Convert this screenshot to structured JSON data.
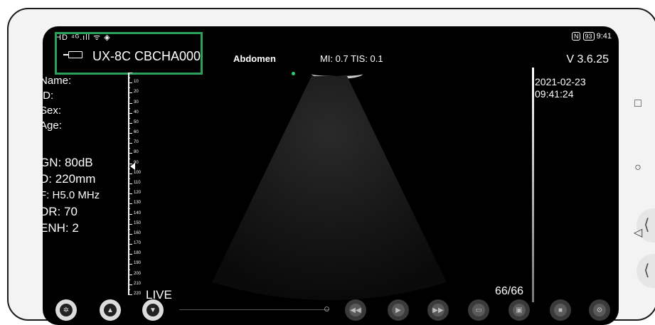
{
  "status_bar": {
    "left_icons": "HD ⁴ᴳ.ıll ᯤ ◈",
    "nfc": "N",
    "battery": "93",
    "time": "9:41"
  },
  "probe": {
    "name": "UX-8C CBCHA000"
  },
  "exam": {
    "preset": "Abdomen",
    "mi_tis": "MI: 0.7  TIS: 0.1"
  },
  "version": "V 3.6.25",
  "patient": {
    "name_label": "Name:",
    "id_label": "ID:",
    "sex_label": "Sex:",
    "age_label": "Age:"
  },
  "imaging": {
    "gain": "GN: 80dB",
    "depth": "D: 220mm",
    "frequency": "F: H5.0 MHz",
    "dynamic_range": "DR: 70",
    "enhancement": "ENH: 2"
  },
  "ruler_labels": [
    "10",
    "20",
    "30",
    "40",
    "50",
    "60",
    "70",
    "80",
    "90",
    "100",
    "110",
    "120",
    "130",
    "140",
    "150",
    "160",
    "170",
    "180",
    "190",
    "200",
    "210",
    "220"
  ],
  "datetime": {
    "date": "2021-02-23",
    "time": "09:41:24"
  },
  "mode": "LIVE",
  "frame_counter": "66/66",
  "controls": {
    "icons": [
      "scan-icon",
      "up-icon",
      "down-icon",
      "rewind-icon",
      "play-icon",
      "forward-icon",
      "measure-icon",
      "save-icon",
      "video-icon",
      "settings-icon"
    ]
  },
  "colors": {
    "frame_highlight": "#2aa05a",
    "screen_bg": "#000000"
  }
}
